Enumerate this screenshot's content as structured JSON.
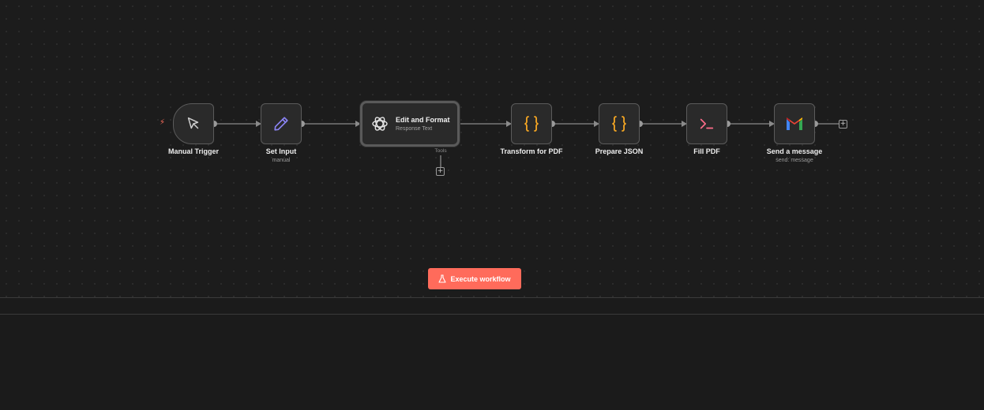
{
  "canvas": {
    "nodes": [
      {
        "id": "manual-trigger",
        "name": "Manual Trigger",
        "subtitle": "",
        "icon": "cursor-arrow-icon"
      },
      {
        "id": "set-input",
        "name": "Set Input",
        "subtitle": "manual",
        "icon": "pencil-icon"
      },
      {
        "id": "edit-and-format",
        "name": "Edit and Format",
        "subtitle": "Response Text",
        "icon": "openai-icon"
      },
      {
        "id": "transform-for-pdf",
        "name": "Transform for PDF",
        "subtitle": "",
        "icon": "code-braces-icon"
      },
      {
        "id": "prepare-json",
        "name": "Prepare JSON",
        "subtitle": "",
        "icon": "code-braces-icon"
      },
      {
        "id": "fill-pdf",
        "name": "Fill PDF",
        "subtitle": "",
        "icon": "terminal-prompt-icon"
      },
      {
        "id": "send-a-message",
        "name": "Send a message",
        "subtitle": "send: message",
        "icon": "gmail-icon"
      }
    ],
    "tools_label": "Tools"
  },
  "toolbar": {
    "execute_label": "Execute workflow"
  },
  "colors": {
    "accent": "#ff6b5b",
    "braces": "#f5a623",
    "pencil": "#8b84f4",
    "terminal": "#ff6d8a",
    "node_bg": "#2a2a2a",
    "node_border": "#5b5b5b"
  }
}
